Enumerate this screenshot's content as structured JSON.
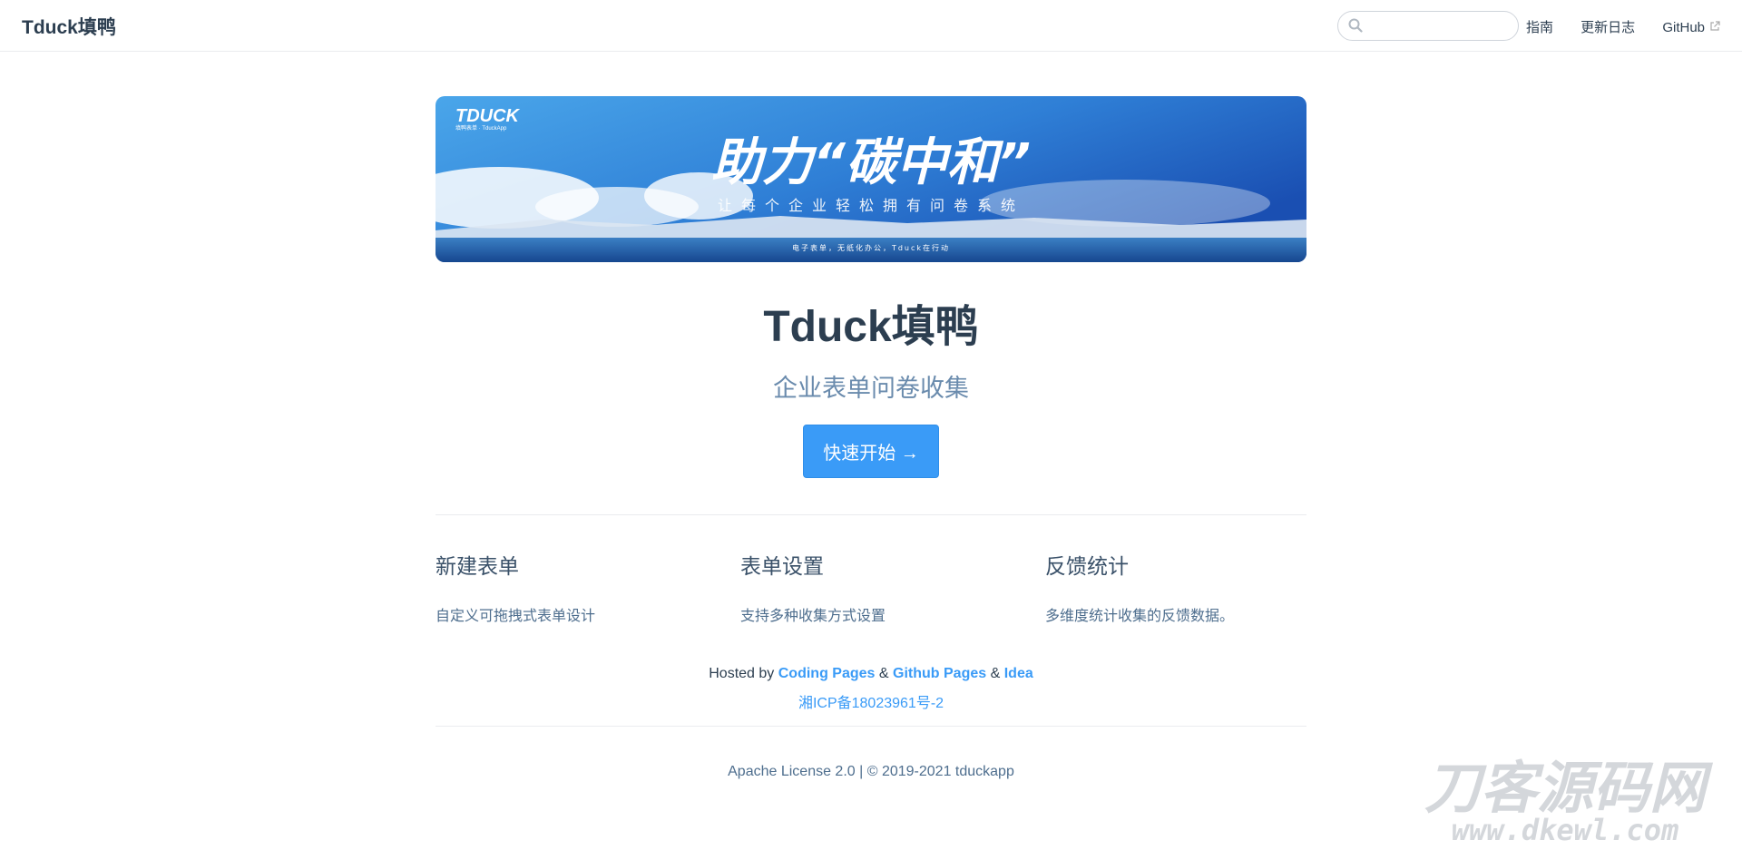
{
  "navbar": {
    "site_name": "Tduck填鸭",
    "search_placeholder": "",
    "links": [
      {
        "label": "指南"
      },
      {
        "label": "更新日志"
      },
      {
        "label": "GitHub"
      }
    ]
  },
  "hero": {
    "banner": {
      "logo": "TDUCK",
      "logo_sub": "填鸭表单 · TduckApp",
      "headline": "助力“碳中和”",
      "tagline": "让每个企业轻松拥有问卷系统",
      "footnote": "电子表单，无纸化办公，Tduck在行动"
    },
    "title": "Tduck填鸭",
    "description": "企业表单问卷收集",
    "action_label": "快速开始 →"
  },
  "features": [
    {
      "title": "新建表单",
      "details": "自定义可拖拽式表单设计"
    },
    {
      "title": "表单设置",
      "details": "支持多种收集方式设置"
    },
    {
      "title": "反馈统计",
      "details": "多维度统计收集的反馈数据。"
    }
  ],
  "hosted": {
    "prefix": "Hosted by",
    "links": [
      "Coding Pages",
      "Github Pages",
      "Idea"
    ],
    "sep": "&",
    "icp": "湘ICP备18023961号-2"
  },
  "footer": {
    "license": "Apache License 2.0 | © 2019-2021 tduckapp"
  },
  "watermark": {
    "text": "刀客源码网",
    "url": "www.dkewl.com"
  },
  "colors": {
    "accent": "#3a9bf7",
    "text": "#2c3e50",
    "muted": "#6a8bad"
  }
}
